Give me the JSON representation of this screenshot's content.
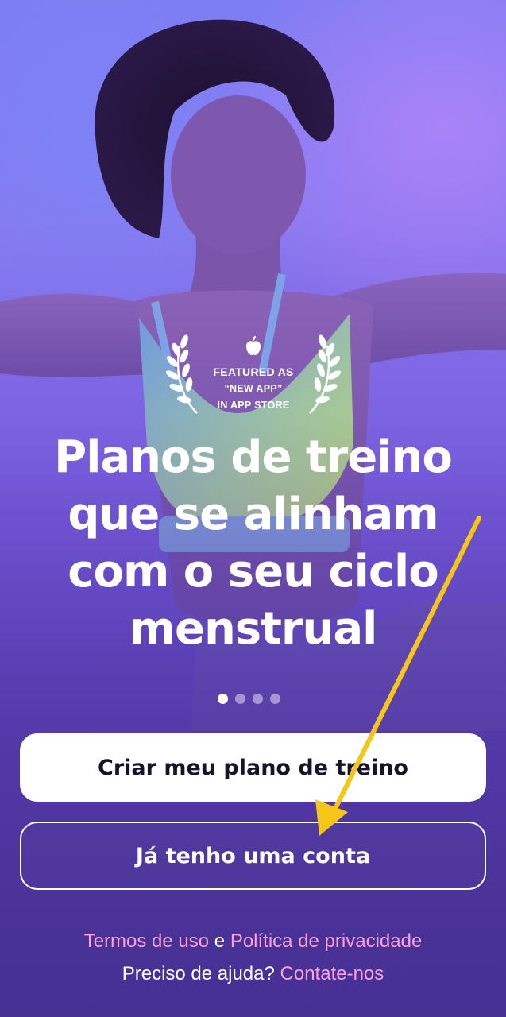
{
  "badge": {
    "line1": "FEATURED AS",
    "line2": "“NEW APP”",
    "line3": "IN APP STORE"
  },
  "headline": {
    "line1": "Planos de treino",
    "line2": "que se alinham",
    "line3": "com o seu ciclo",
    "line4": "menstrual"
  },
  "pager": {
    "total": 4,
    "active": 1
  },
  "buttons": {
    "primary": "Criar meu plano de treino",
    "secondary": "Já tenho uma conta"
  },
  "footer": {
    "terms": "Termos de uso",
    "and": "e",
    "privacy": "Política de privacidade",
    "help_question": "Preciso de ajuda?",
    "contact": "Contate-nos"
  },
  "colors": {
    "link": "#ff9fd8",
    "annotation_arrow": "#f5c518",
    "primary_button_bg": "#ffffff"
  },
  "icons": [
    "apple-icon",
    "laurel-left-icon",
    "laurel-right-icon"
  ]
}
